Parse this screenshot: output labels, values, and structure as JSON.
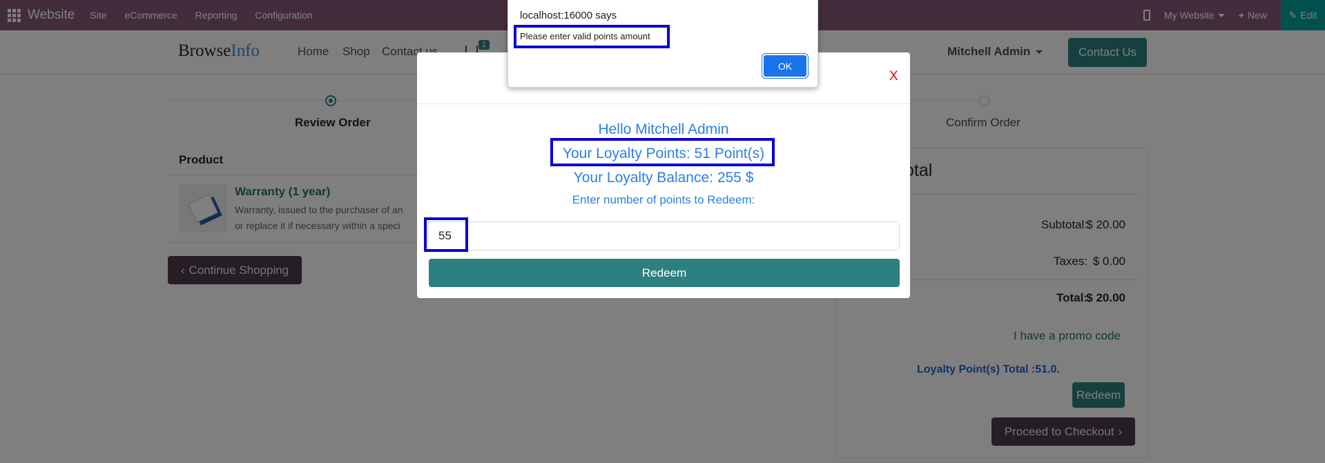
{
  "admin_bar": {
    "brand": "Website",
    "menus": [
      "Site",
      "eCommerce",
      "Reporting",
      "Configuration"
    ],
    "my_website": "My Website",
    "new_label": "New",
    "edit_label": "Edit"
  },
  "site_header": {
    "logo_part1": "Browse",
    "logo_part2": "Info",
    "nav": [
      "Home",
      "Shop",
      "Contact us"
    ],
    "cart_count": "1",
    "user": "Mitchell Admin",
    "contact_button": "Contact Us"
  },
  "steps": {
    "review": "Review Order",
    "confirm": "Confirm Order"
  },
  "cart": {
    "product_header": "Product",
    "product_name": "Warranty (1 year)",
    "product_desc_line1": "Warranty, issued to the purchaser of an",
    "product_desc_line2": "or replace it if necessary within a speci",
    "continue_label": "Continue Shopping"
  },
  "summary": {
    "title_fragment": "otal",
    "subtotal_label": "Subtotal:",
    "subtotal_value": "$ 20.00",
    "taxes_label": "Taxes:",
    "taxes_value": "$ 0.00",
    "total_label": "Total:",
    "total_value": "$ 20.00",
    "promo": "I have a promo code",
    "loyalty_total": "Loyalty Point(s) Total :51.0.",
    "redeem_label": "Redeem",
    "checkout_label": "Proceed to Checkout"
  },
  "modal": {
    "close": "X",
    "hello": "Hello  Mitchell Admin",
    "points": "Your Loyalty Points: 51 Point(s)",
    "balance": "Your Loyalty Balance:  255  $",
    "prompt": "Enter number of points to Redeem:",
    "input_value": "55",
    "redeem_label": "Redeem"
  },
  "alert": {
    "title": "localhost:16000 says",
    "message": "Please enter valid points amount",
    "ok": "OK"
  },
  "colors": {
    "admin_bar": "#875a7b",
    "primary": "#2d8080",
    "highlight_outline": "#0a00d6",
    "loyalty_text": "#2b7ee6"
  }
}
